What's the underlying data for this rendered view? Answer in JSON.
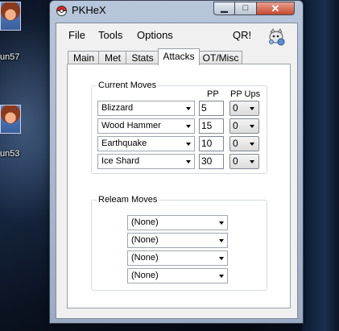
{
  "window": {
    "title": "PKHeX",
    "minimize_glyph": "▁",
    "maximize_glyph": "□",
    "close_glyph": "✕"
  },
  "desktop": {
    "icons": [
      {
        "label": "un57"
      },
      {
        "label": "un53"
      }
    ]
  },
  "menu": {
    "file": "File",
    "tools": "Tools",
    "options": "Options",
    "qr": "QR!"
  },
  "tabs": [
    {
      "label": "Main"
    },
    {
      "label": "Met"
    },
    {
      "label": "Stats"
    },
    {
      "label": "Attacks",
      "active": true
    },
    {
      "label": "OT/Misc"
    }
  ],
  "current_moves": {
    "title": "Current Moves",
    "pp_header": "PP",
    "ppups_header": "PP Ups",
    "moves": [
      {
        "name": "Blizzard",
        "pp": "5",
        "pp_ups": "0"
      },
      {
        "name": "Wood Hammer",
        "pp": "15",
        "pp_ups": "0"
      },
      {
        "name": "Earthquake",
        "pp": "10",
        "pp_ups": "0"
      },
      {
        "name": "Ice Shard",
        "pp": "30",
        "pp_ups": "0"
      }
    ]
  },
  "relearn_moves": {
    "title": "Releam Moves",
    "moves": [
      "(None)",
      "(None)",
      "(None)",
      "(None)"
    ]
  },
  "icons": {
    "app": "pokeball-icon",
    "sprite": "pokemon-sprite-icon"
  }
}
